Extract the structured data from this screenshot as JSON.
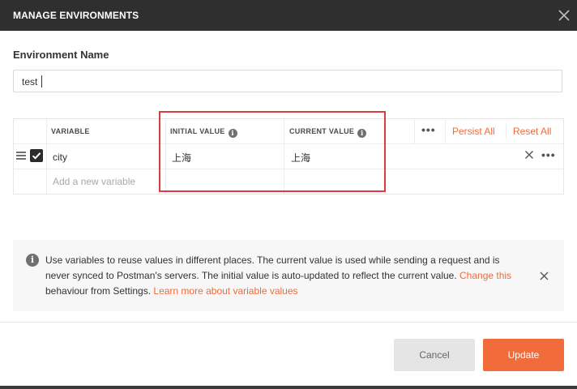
{
  "dialog": {
    "title": "MANAGE ENVIRONMENTS"
  },
  "environment": {
    "label": "Environment Name",
    "value": "test"
  },
  "table": {
    "columns": {
      "variable": "VARIABLE",
      "initial_value": "INITIAL VALUE",
      "current_value": "CURRENT VALUE"
    },
    "info_glyph": "i",
    "more_glyph": "•••",
    "persist_all": "Persist All",
    "reset_all": "Reset All",
    "rows": [
      {
        "checked": true,
        "variable": "city",
        "initial_value": "上海",
        "current_value": "上海"
      }
    ],
    "new_variable_placeholder": "Add a new variable"
  },
  "notice": {
    "icon": "i",
    "text_before": "Use variables to reuse values in different places. The current value is used while sending a request and is never synced to Postman's servers. The initial value is auto-updated to reflect the current value. ",
    "link_change": "Change this",
    "text_middle": " behaviour from Settings. ",
    "link_learn": "Learn more about variable values"
  },
  "footer": {
    "cancel_label": "Cancel",
    "update_label": "Update"
  },
  "colors": {
    "accent": "#f26b3a",
    "titlebar": "#2f2f2f",
    "highlight": "#e0393e"
  }
}
